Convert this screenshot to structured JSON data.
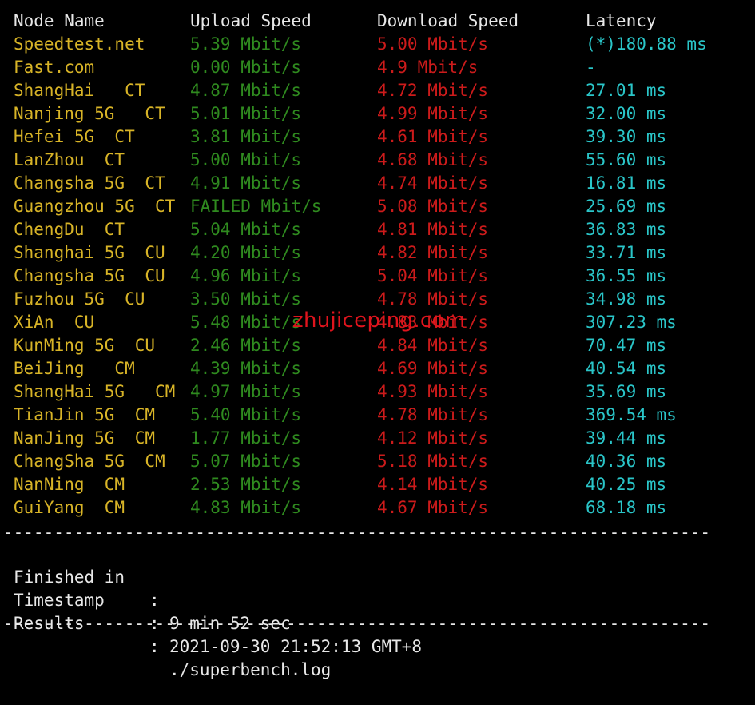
{
  "colors": {
    "background": "#000000",
    "header_text": "#e8e8e8",
    "node_name": "#d8b427",
    "upload": "#2f8a1f",
    "download": "#cc1b1b",
    "latency": "#2ac6c9",
    "watermark": "#e0141d"
  },
  "header": {
    "node_name": "Node Name",
    "upload_speed": "Upload Speed",
    "download_speed": "Download Speed",
    "latency": "Latency"
  },
  "rows": [
    {
      "node": "Speedtest.net",
      "upload": "5.39 Mbit/s",
      "download": "5.00 Mbit/s",
      "latency": "(*)180.88 ms"
    },
    {
      "node": "Fast.com",
      "upload": "0.00 Mbit/s",
      "download": "4.9 Mbit/s",
      "latency": "-"
    },
    {
      "node": "ShangHai   CT",
      "upload": "4.87 Mbit/s",
      "download": "4.72 Mbit/s",
      "latency": "27.01 ms"
    },
    {
      "node": "Nanjing 5G   CT",
      "upload": "5.01 Mbit/s",
      "download": "4.99 Mbit/s",
      "latency": "32.00 ms"
    },
    {
      "node": "Hefei 5G  CT",
      "upload": "3.81 Mbit/s",
      "download": "4.61 Mbit/s",
      "latency": "39.30 ms"
    },
    {
      "node": "LanZhou  CT",
      "upload": "5.00 Mbit/s",
      "download": "4.68 Mbit/s",
      "latency": "55.60 ms"
    },
    {
      "node": "Changsha 5G  CT",
      "upload": "4.91 Mbit/s",
      "download": "4.74 Mbit/s",
      "latency": "16.81 ms"
    },
    {
      "node": "Guangzhou 5G  CT",
      "upload": "FAILED Mbit/s",
      "download": "5.08 Mbit/s",
      "latency": "25.69 ms"
    },
    {
      "node": "ChengDu  CT",
      "upload": "5.04 Mbit/s",
      "download": "4.81 Mbit/s",
      "latency": "36.83 ms"
    },
    {
      "node": "Shanghai 5G  CU",
      "upload": "4.20 Mbit/s",
      "download": "4.82 Mbit/s",
      "latency": "33.71 ms"
    },
    {
      "node": "Changsha 5G  CU",
      "upload": "4.96 Mbit/s",
      "download": "5.04 Mbit/s",
      "latency": "36.55 ms"
    },
    {
      "node": "Fuzhou 5G  CU",
      "upload": "3.50 Mbit/s",
      "download": "4.78 Mbit/s",
      "latency": "34.98 ms"
    },
    {
      "node": "XiAn  CU",
      "upload": "5.48 Mbit/s",
      "download": "4.83 Mbit/s",
      "latency": "307.23 ms"
    },
    {
      "node": "KunMing 5G  CU",
      "upload": "2.46 Mbit/s",
      "download": "4.84 Mbit/s",
      "latency": "70.47 ms"
    },
    {
      "node": "BeiJing   CM",
      "upload": "4.39 Mbit/s",
      "download": "4.69 Mbit/s",
      "latency": "40.54 ms"
    },
    {
      "node": "ShangHai 5G   CM",
      "upload": "4.97 Mbit/s",
      "download": "4.93 Mbit/s",
      "latency": "35.69 ms"
    },
    {
      "node": "TianJin 5G  CM",
      "upload": "5.40 Mbit/s",
      "download": "4.78 Mbit/s",
      "latency": "369.54 ms"
    },
    {
      "node": "NanJing 5G  CM",
      "upload": "1.77 Mbit/s",
      "download": "4.12 Mbit/s",
      "latency": "39.44 ms"
    },
    {
      "node": "ChangSha 5G  CM",
      "upload": "5.07 Mbit/s",
      "download": "5.18 Mbit/s",
      "latency": "40.36 ms"
    },
    {
      "node": "NanNing  CM",
      "upload": "2.53 Mbit/s",
      "download": "4.14 Mbit/s",
      "latency": "40.25 ms"
    },
    {
      "node": "GuiYang  CM",
      "upload": "4.83 Mbit/s",
      "download": "4.67 Mbit/s",
      "latency": "68.18 ms"
    }
  ],
  "divider": "----------------------------------------------------------------------",
  "summary": {
    "finished_key": "Finished in",
    "finished_val": "9 min 52 sec",
    "timestamp_key": "Timestamp",
    "timestamp_val": "2021-09-30 21:52:13 GMT+8",
    "results_key": "Results",
    "results_val": "./superbench.log",
    "separator": ":"
  },
  "watermark": "zhujiceping.com"
}
